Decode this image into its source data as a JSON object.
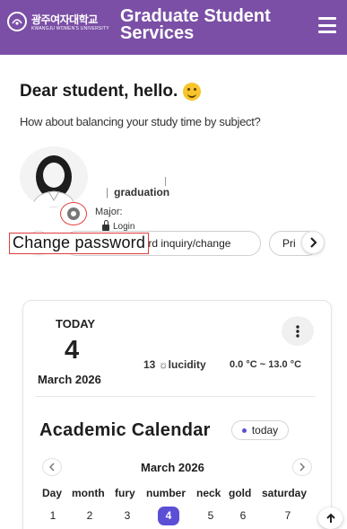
{
  "header": {
    "logo_kr": "광주여자대학교",
    "logo_en": "KWANGJU WOMEN'S UNIVERSITY",
    "title": "Graduate Student Services",
    "menu_icon": "hamburger-menu-icon",
    "colors": {
      "bar": "#7b4fa6",
      "text": "#ffffff"
    }
  },
  "greeting": {
    "text": "Dear student, hello.",
    "emoji_icon": "smiley-icon",
    "subtitle": "How about balancing your study time by subject?"
  },
  "profile": {
    "avatar_icon": "student-avatar-icon",
    "settings_icon": "gear-icon",
    "separator": "|",
    "program": "graduation",
    "major_label": "Major:",
    "login_label": "Login",
    "change_password": "Change password"
  },
  "chips": {
    "prev_icon": "chevron-left-icon",
    "next_icon": "chevron-right-icon",
    "items": [
      "Academic record inquiry/change",
      "Pri"
    ]
  },
  "today_card": {
    "label": "TODAY",
    "day": "4",
    "month_year": "March 2026",
    "weather": "13 ☼lucidity",
    "temperature": "0.0 °C ~ 13.0 °C",
    "more_icon": "vertical-dots-icon"
  },
  "calendar": {
    "title": "Academic Calendar",
    "today_button": "today",
    "month": "March 2026",
    "prev_icon": "chevron-left-icon",
    "next_icon": "chevron-right-icon",
    "weekdays": [
      "Day",
      "month",
      "fury",
      "number",
      "neck",
      "gold",
      "saturday"
    ],
    "days": [
      "1",
      "2",
      "3",
      "4",
      "5",
      "6",
      "7"
    ],
    "selected_day": "4",
    "accent": "#5b4fd6"
  },
  "scroll_top_icon": "arrow-up-icon"
}
